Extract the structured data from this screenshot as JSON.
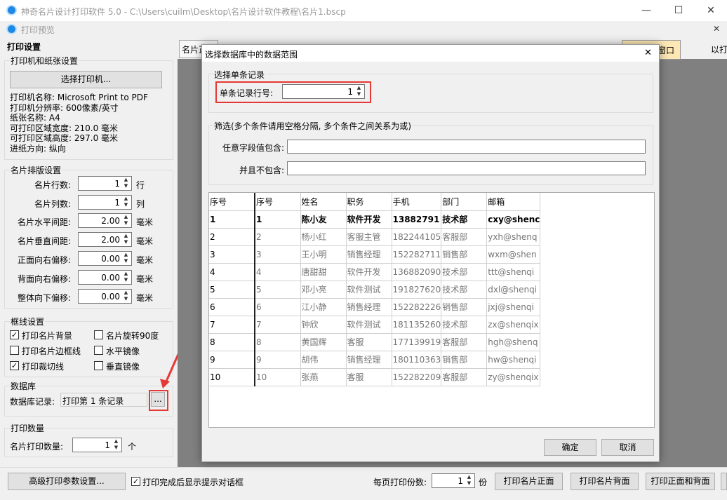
{
  "window": {
    "title": "神奇名片设计打印软件 5.0 - C:\\Users\\cuilm\\Desktop\\名片设计软件教程\\名片1.bscp",
    "minimize": "—",
    "maximize": "☐",
    "close": "✕"
  },
  "subwindow": {
    "title": "打印预览",
    "close": "✕"
  },
  "left": {
    "header": "打印设置",
    "printer": {
      "title": "打印机和纸张设置",
      "button": "选择打印机...",
      "info": [
        "打印机名称: Microsoft Print to PDF",
        "打印机分辨率: 600像素/英寸",
        "纸张名称: A4",
        "可打印区域宽度: 210.0 毫米",
        "可打印区域高度: 297.0 毫米",
        "进纸方向: 纵向"
      ]
    },
    "layout": {
      "title": "名片排版设置",
      "rows": [
        {
          "label": "名片行数:",
          "value": "1",
          "unit": "行"
        },
        {
          "label": "名片列数:",
          "value": "1",
          "unit": "列"
        },
        {
          "label": "名片水平间距:",
          "value": "2.00",
          "unit": "毫米"
        },
        {
          "label": "名片垂直间距:",
          "value": "2.00",
          "unit": "毫米"
        },
        {
          "label": "正面向右偏移:",
          "value": "0.00",
          "unit": "毫米"
        },
        {
          "label": "背面向右偏移:",
          "value": "0.00",
          "unit": "毫米"
        },
        {
          "label": "整体向下偏移:",
          "value": "0.00",
          "unit": "毫米"
        }
      ]
    },
    "frame": {
      "title": "框线设置",
      "checks": [
        {
          "label": "打印名片背景",
          "checked": true
        },
        {
          "label": "名片旋转90度",
          "checked": false
        },
        {
          "label": "打印名片边框线",
          "checked": false
        },
        {
          "label": "水平镜像",
          "checked": false
        },
        {
          "label": "打印裁切线",
          "checked": true
        },
        {
          "label": "垂直镜像",
          "checked": false
        }
      ]
    },
    "database": {
      "title": "数据库",
      "label": "数据库记录:",
      "value": "打印第 1 条记录",
      "button": "..."
    },
    "count": {
      "title": "打印数量",
      "label": "名片打印数量:",
      "value": "1",
      "unit": "个"
    }
  },
  "toolbar": {
    "tab": "名片正",
    "window_btn": "窗口",
    "fit": "以打"
  },
  "bottom": {
    "advanced": "高级打印参数设置...",
    "showdlg": "打印完成后显示提示对话框",
    "showdlg_checked": true,
    "per_page_label": "每页打印份数:",
    "per_page": "1",
    "per_page_unit": "份",
    "print_front": "打印名片正面",
    "print_back": "打印名片背面",
    "print_both": "打印正面和背面"
  },
  "dialog": {
    "title": "选择数据库中的数据范围",
    "close": "✕",
    "single": {
      "group": "选择单条记录",
      "label": "单条记录行号:",
      "value": "1"
    },
    "filter": {
      "group": "筛选(多个条件请用空格分隔, 多个条件之间关系为或)",
      "contains": "任意字段值包含:",
      "excludes": "并且不包含:"
    },
    "grid": {
      "headers": [
        "序号",
        "序号",
        "姓名",
        "职务",
        "手机",
        "部门",
        "邮箱"
      ],
      "rows": [
        [
          "1",
          "1",
          "陈小友",
          "软件开发",
          "13882791",
          "技术部",
          "cxy@shenc"
        ],
        [
          "2",
          "2",
          "杨小红",
          "客服主管",
          "182244105",
          "客服部",
          "yxh@shenq"
        ],
        [
          "3",
          "3",
          "王小明",
          "销售经理",
          "152282711",
          "销售部",
          "wxm@shen"
        ],
        [
          "4",
          "4",
          "唐甜甜",
          "软件开发",
          "136882090",
          "技术部",
          "ttt@shenqi"
        ],
        [
          "5",
          "5",
          "邓小亮",
          "软件测试",
          "191827620",
          "技术部",
          "dxl@shenqi"
        ],
        [
          "6",
          "6",
          "江小静",
          "销售经理",
          "152282226",
          "销售部",
          "jxj@shenqi"
        ],
        [
          "7",
          "7",
          "钟欣",
          "软件测试",
          "181135260",
          "技术部",
          "zx@shenqix"
        ],
        [
          "8",
          "8",
          "黄国辉",
          "客服",
          "177139919",
          "客服部",
          "hgh@shenq"
        ],
        [
          "9",
          "9",
          "胡伟",
          "销售经理",
          "180110363",
          "销售部",
          "hw@shenqi"
        ],
        [
          "10",
          "10",
          "张燕",
          "客服",
          "152282209",
          "客服部",
          "zy@shenqix"
        ]
      ]
    },
    "ok": "确定",
    "cancel": "取消"
  },
  "colors": {
    "highlight": "#e53935",
    "accent": "#1e88e5"
  }
}
